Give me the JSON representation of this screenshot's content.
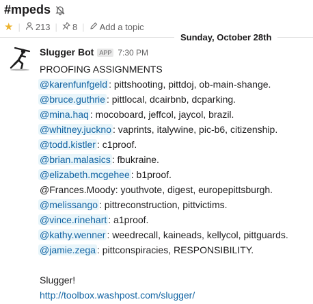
{
  "channel": {
    "name": "#mpeds",
    "members_count": "213",
    "pinned_count": "8",
    "add_topic_label": "Add a topic"
  },
  "date_divider": "Sunday, October 28th",
  "message": {
    "sender": "Slugger Bot",
    "badge": "APP",
    "time": "7:30 PM",
    "heading": "PROOFING ASSIGNMENTS",
    "assignments": [
      {
        "mention": "@karenfunfgeld",
        "text": ": pittshooting, pittdoj, ob-main-shange."
      },
      {
        "mention": "@bruce.guthrie",
        "text": ": pittlocal, dcairbnb, dcparking."
      },
      {
        "mention": "@mina.haq",
        "text": ": mocoboard, jeffcol, jaycol, brazil."
      },
      {
        "mention": "@whitney.juckno",
        "text": ": vaprints, italywine, pic-b6, citizenship."
      },
      {
        "mention": "@todd.kistler",
        "text": ": c1proof."
      },
      {
        "mention": "@brian.malasics",
        "text": ": fbukraine."
      },
      {
        "mention": "@elizabeth.mcgehee",
        "text": ": b1proof."
      },
      {
        "plain": "@Frances.Moody",
        "text": ": youthvote, digest, europepittsburgh."
      },
      {
        "mention": "@melissango",
        "text": ": pittreconstruction, pittvictims."
      },
      {
        "mention": "@vince.rinehart",
        "text": ": a1proof."
      },
      {
        "mention": "@kathy.wenner",
        "text": ": weedrecall, kaineads, kellycol, pittguards."
      },
      {
        "mention": "@jamie.zega",
        "text": ": pittconspiracies, RESPONSIBILITY."
      }
    ],
    "signoff": "Slugger!",
    "url": "http://toolbox.washpost.com/slugger/"
  },
  "colors": {
    "mention_text": "#1264a3",
    "mention_bg": "#e8f5fa",
    "star": "#ecb22e",
    "muted": "#616061"
  },
  "icons": [
    "bell-off-icon",
    "star-icon",
    "person-icon",
    "pin-icon",
    "pencil-icon"
  ]
}
